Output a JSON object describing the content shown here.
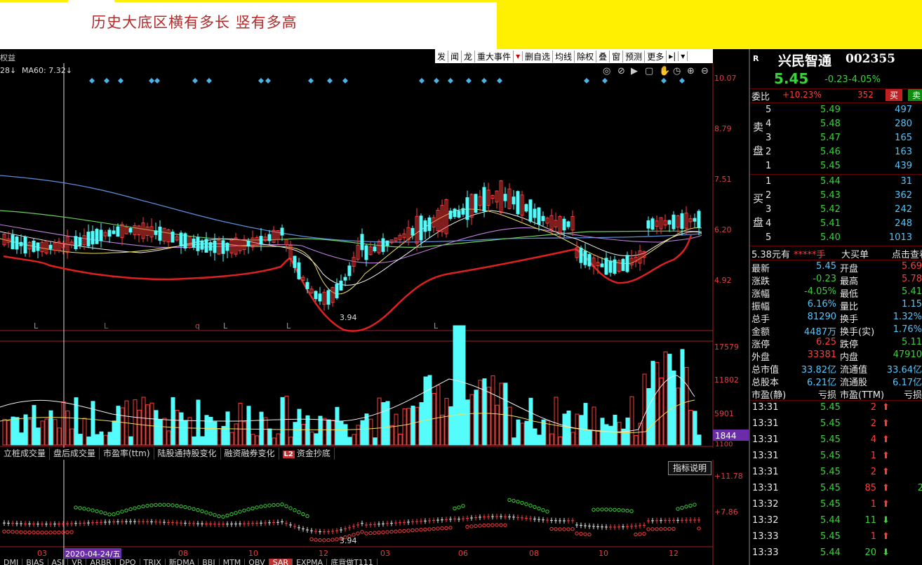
{
  "banner": {
    "title": "历史大底区横有多长 竖有多高"
  },
  "toolbar": {
    "left_label": "权益",
    "items": [
      "发",
      "闻",
      "龙",
      "重大事件",
      "▾",
      "删自选",
      "均线",
      "除权",
      "叠",
      "窗",
      "预测",
      "更多",
      "▸|",
      "▾"
    ]
  },
  "ma_header": {
    "ma_left": "28↓",
    "ma60": "MA60: 7.32↓"
  },
  "price_axis": [
    "10.07",
    "8.79",
    "7.51",
    "6.20",
    "4.92"
  ],
  "low_marker": "3.94",
  "volume_axis": [
    "17579",
    "11802",
    "5901"
  ],
  "volume_current": "1844",
  "volume_cut": "1100",
  "l_markers": [
    "L",
    "L",
    "q",
    "L",
    "L",
    "L"
  ],
  "indicator_tabs": [
    "立桩成交量",
    "盘后成交量",
    "市盈率(ttm)",
    "陆股通持股变化",
    "融资融券变化",
    "L2",
    "资金抄底"
  ],
  "indicator_explain": "指标说明",
  "sar_axis": [
    "+11.78",
    "+7.86"
  ],
  "sar_low": "3.94",
  "date_axis": [
    "03",
    "08",
    "10",
    "12",
    "03",
    "06",
    "08",
    "10",
    "12"
  ],
  "cursor_date": "2020-04-24/五",
  "bottom_tabs": [
    "DMI",
    "BIAS",
    "ASI",
    "VR",
    "ARBR",
    "DPO",
    "TRIX",
    "新DMA",
    "BBI",
    "MTM",
    "OBV",
    "SAR",
    "EXPMA",
    "底背做T111"
  ],
  "stock": {
    "tag": "R",
    "name": "兴民智通",
    "code": "002355",
    "price": "5.45",
    "change": "-0.23",
    "change_pct": "-4.05%"
  },
  "order_ratio": {
    "label": "委比",
    "value": "+10.23%",
    "diff": "352",
    "buy_btn": "买",
    "sell_btn": "卖"
  },
  "sell_side_label": [
    "卖",
    "盘"
  ],
  "buy_side_label": [
    "买",
    "盘"
  ],
  "sell_book": [
    {
      "level": "5",
      "price": "5.49",
      "vol": "497"
    },
    {
      "level": "4",
      "price": "5.48",
      "vol": "280"
    },
    {
      "level": "3",
      "price": "5.47",
      "vol": "165"
    },
    {
      "level": "2",
      "price": "5.46",
      "vol": "163"
    },
    {
      "level": "1",
      "price": "5.45",
      "vol": "439"
    }
  ],
  "buy_book": [
    {
      "level": "1",
      "price": "5.44",
      "vol": "31"
    },
    {
      "level": "2",
      "price": "5.43",
      "vol": "362"
    },
    {
      "level": "3",
      "price": "5.42",
      "vol": "242"
    },
    {
      "level": "4",
      "price": "5.41",
      "vol": "248"
    },
    {
      "level": "5",
      "price": "5.40",
      "vol": "1013"
    }
  ],
  "big_order": {
    "left": "5.38元有",
    "stars": "*****手",
    "mid": "大买单",
    "right": "点击查看"
  },
  "stats": [
    {
      "l": "最新",
      "lv": "5.45",
      "r": "开盘",
      "rv": "5.69"
    },
    {
      "l": "涨跌",
      "lv": "-0.23",
      "r": "最高",
      "rv": "5.78"
    },
    {
      "l": "涨幅",
      "lv": "-4.05%",
      "r": "最低",
      "rv": "5.41"
    },
    {
      "l": "振幅",
      "lv": "6.16%",
      "r": "量比",
      "rv": "1.15"
    },
    {
      "l": "总手",
      "lv": "81290",
      "r": "换手",
      "rv": "1.32%"
    },
    {
      "l": "金额",
      "lv": "4487万",
      "r": "换手(实)",
      "rv": "1.76%"
    },
    {
      "l": "涨停",
      "lv": "6.25",
      "r": "跌停",
      "rv": "5.11"
    },
    {
      "l": "外盘",
      "lv": "33381",
      "r": "内盘",
      "rv": "47910"
    },
    {
      "l": "总市值",
      "lv": "33.82亿",
      "r": "流通值",
      "rv": "33.64亿"
    },
    {
      "l": "总股本",
      "lv": "6.21亿",
      "r": "流通股",
      "rv": "6.17亿"
    },
    {
      "l": "市盈(静)",
      "lv": "亏损",
      "r": "市盈(TTM)",
      "rv": "亏损"
    }
  ],
  "trades": [
    {
      "time": "13:31",
      "price": "5.45",
      "vol": "2",
      "dir": "up",
      "extra": ""
    },
    {
      "time": "13:31",
      "price": "5.45",
      "vol": "2",
      "dir": "up",
      "extra": ""
    },
    {
      "time": "13:31",
      "price": "5.45",
      "vol": "4",
      "dir": "up",
      "extra": ""
    },
    {
      "time": "13:31",
      "price": "5.45",
      "vol": "1",
      "dir": "up",
      "extra": ""
    },
    {
      "time": "13:31",
      "price": "5.45",
      "vol": "2",
      "dir": "up",
      "extra": ""
    },
    {
      "time": "13:31",
      "price": "5.45",
      "vol": "85",
      "dir": "up",
      "extra": "2"
    },
    {
      "time": "13:32",
      "price": "5.45",
      "vol": "1",
      "dir": "up",
      "extra": ""
    },
    {
      "time": "13:32",
      "price": "5.44",
      "vol": "11",
      "dir": "down",
      "extra": ""
    },
    {
      "time": "13:33",
      "price": "5.45",
      "vol": "1",
      "dir": "up",
      "extra": ""
    },
    {
      "time": "13:33",
      "price": "5.44",
      "vol": "20",
      "dir": "down",
      "extra": ""
    }
  ],
  "colors": {
    "up": "#ff3c3c",
    "down": "#3ad33a",
    "cyan_bar": "#54fcfc",
    "banner_bg": "#ffef00"
  }
}
